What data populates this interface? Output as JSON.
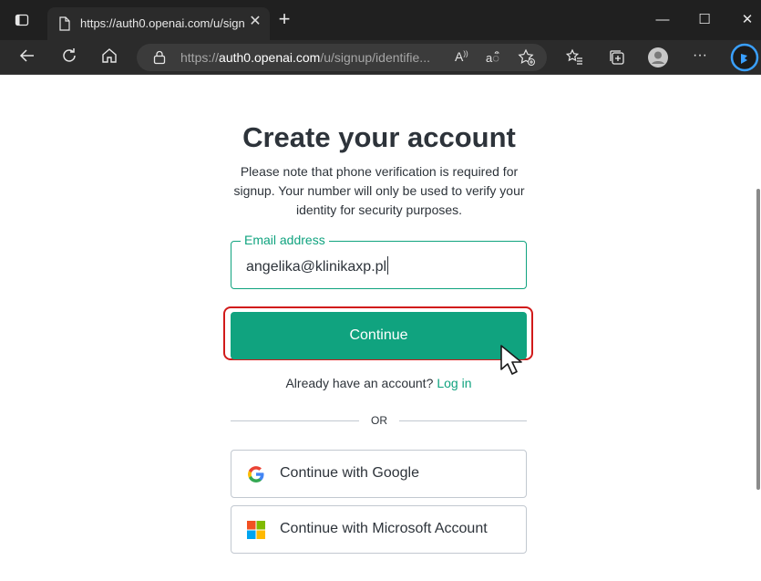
{
  "browser": {
    "tab_title": "https://auth0.openai.com/u/signup",
    "url_prefix": "https://",
    "url_host": "auth0.openai.com",
    "url_path": "/u/signup/identifie...",
    "read_aloud_label": "A",
    "translate_label": "aऀ",
    "more_label": "···"
  },
  "page": {
    "title": "Create your account",
    "note": "Please note that phone verification is required for signup. Your number will only be used to verify your identity for security purposes.",
    "email_label": "Email address",
    "email_value": "angelika@klinikaxp.pl",
    "continue_label": "Continue",
    "have_account_text": "Already have an account?",
    "login_label": "Log in",
    "or_label": "OR",
    "google_label": "Continue with Google",
    "microsoft_label": "Continue with Microsoft Account"
  },
  "colors": {
    "accent": "#10a37f",
    "highlight": "#d11a1a"
  }
}
